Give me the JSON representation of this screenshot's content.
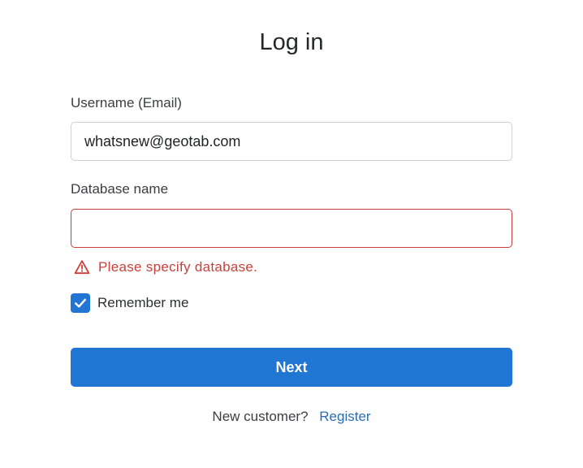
{
  "header": {
    "title": "Log in"
  },
  "form": {
    "username": {
      "label": "Username (Email)",
      "value": "whatsnew@geotab.com",
      "placeholder": ""
    },
    "database": {
      "label": "Database name",
      "value": "",
      "placeholder": "",
      "error": "Please specify database."
    },
    "remember": {
      "label": "Remember me",
      "checked": true
    },
    "submit_label": "Next"
  },
  "footer": {
    "prompt": "New customer?",
    "link_label": "Register"
  },
  "icons": {
    "error": "warning-triangle-icon",
    "checkbox": "checkmark-icon"
  },
  "colors": {
    "primary": "#2175d3",
    "error": "#c9403a",
    "link": "#2a6cb4",
    "input_border": "#cdd2d7"
  }
}
